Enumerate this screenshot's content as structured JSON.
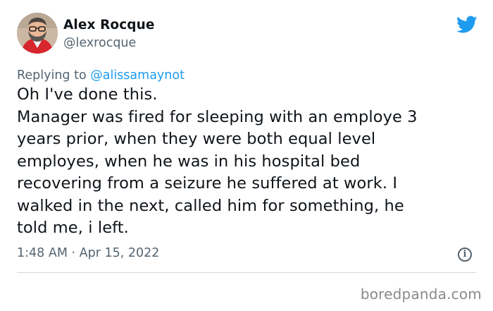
{
  "author": {
    "name": "Alex Rocque",
    "handle": "@lexrocque"
  },
  "reply": {
    "prefix": "Replying to ",
    "mention": "@alissamaynot"
  },
  "tweet": {
    "lines": [
      "Oh I've done this.",
      "Manager was fired for sleeping with an employe 3",
      "years prior, when they were both equal level",
      "employes, when he was in his hospital bed",
      "recovering from a seizure he suffered at work. I",
      "walked in the next, called him for something, he",
      "told me, i left."
    ]
  },
  "meta": {
    "timestamp": "1:48 AM · Apr 15, 2022"
  },
  "icons": {
    "brand": "twitter-bird-icon",
    "info": "info-icon"
  },
  "colors": {
    "twitter_blue": "#1d9bf0",
    "secondary_text": "#536471",
    "divider": "#cfd9de"
  },
  "credit": "boredpanda.com"
}
